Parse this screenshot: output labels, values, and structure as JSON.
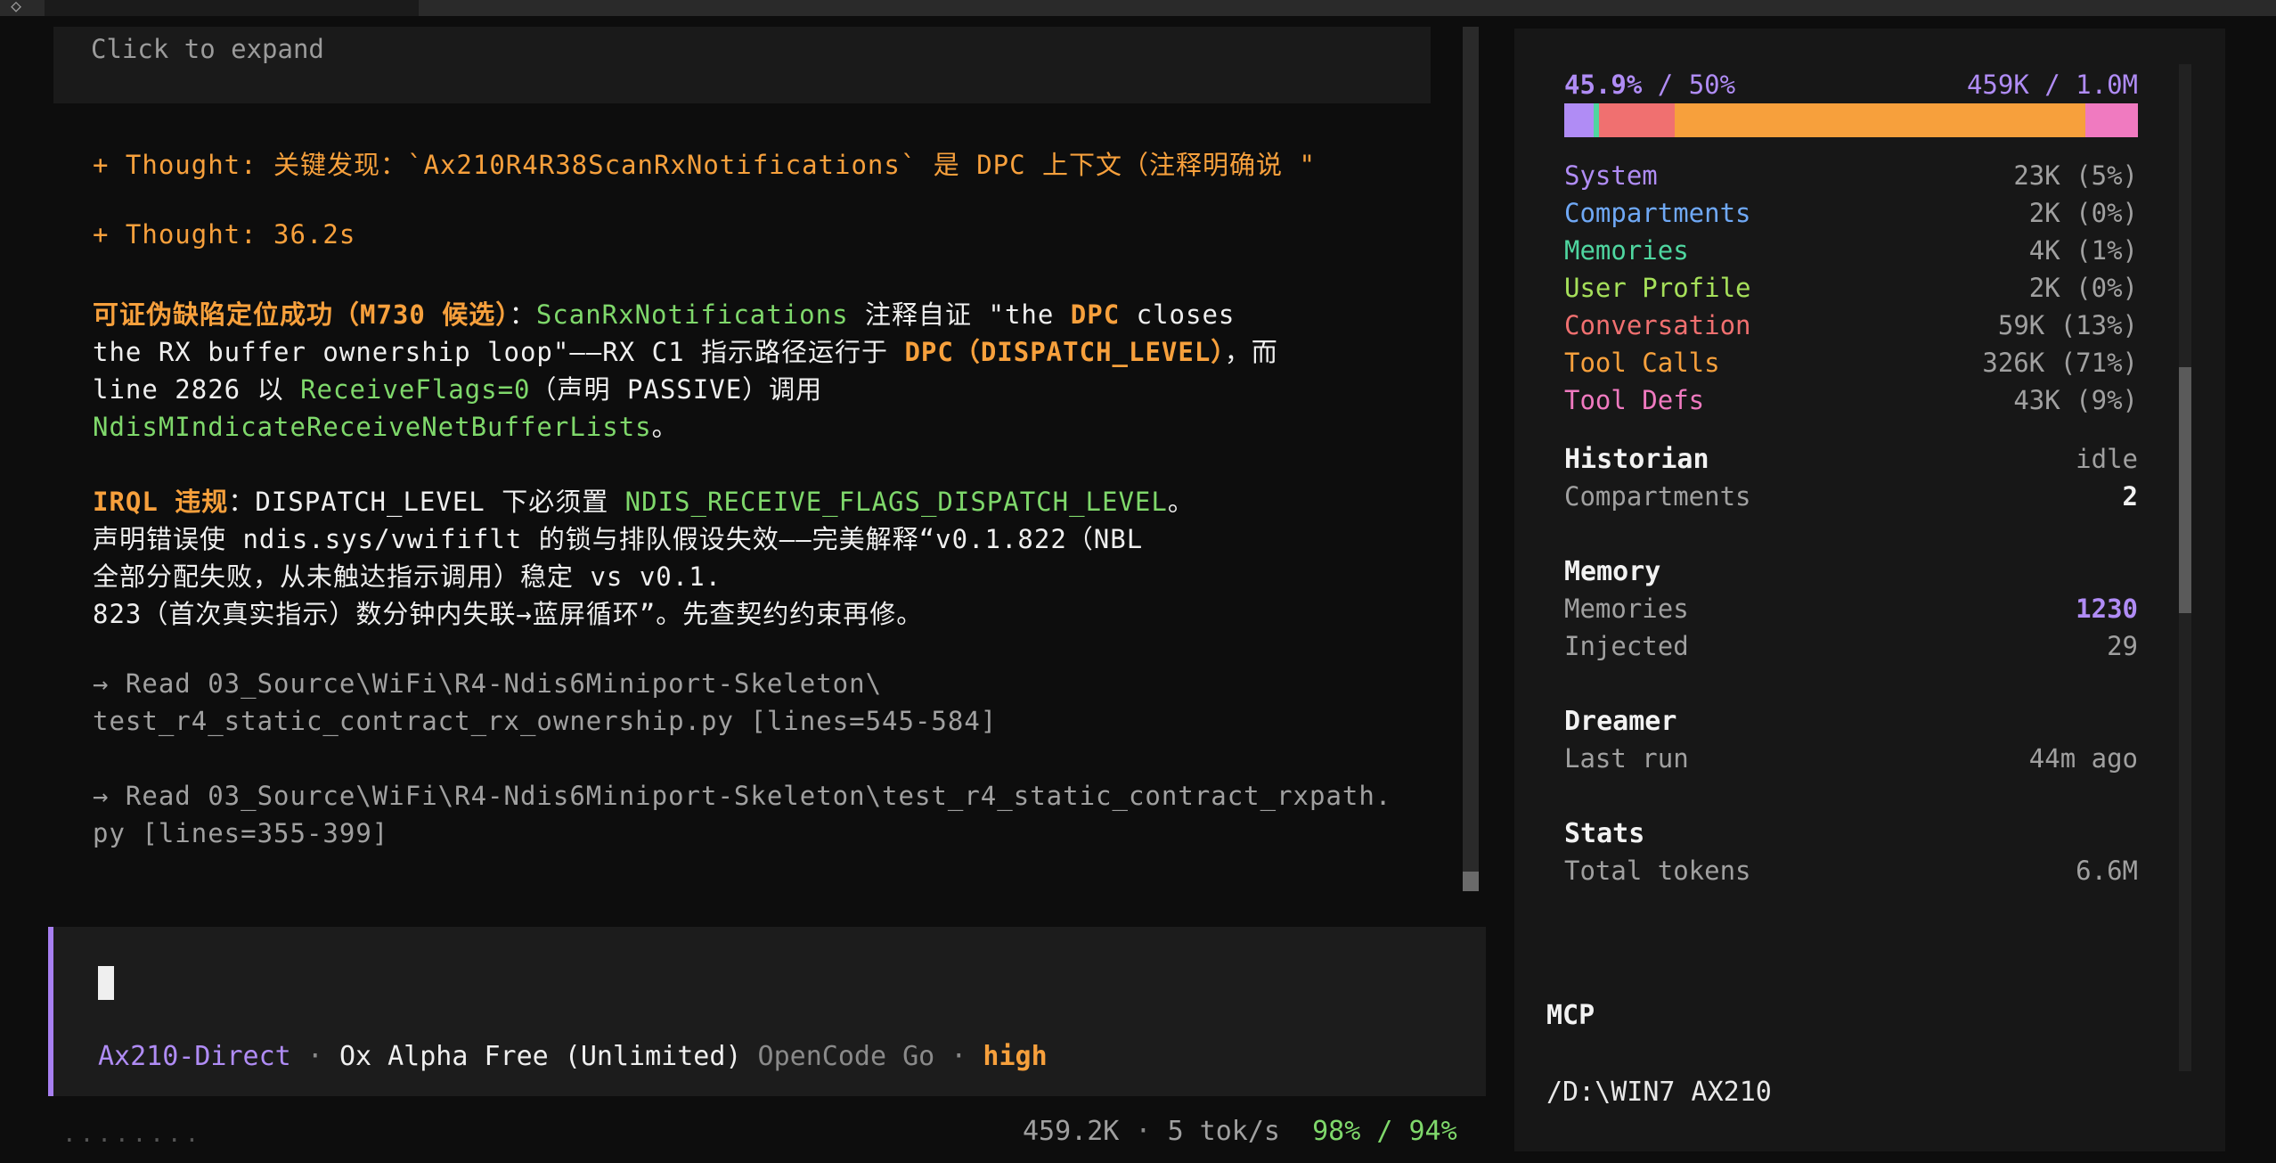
{
  "transcript": {
    "expand_hint": "Click to expand",
    "thought1": "+ Thought: 关键发现：`Ax210R4R38ScanRxNotifications` 是 DPC 上下文（注释明确说 \"",
    "thought2": "+ Thought: 36.2s",
    "p1_l1_a": "可证伪缺陷定位成功（M730 候选）",
    "p1_l1_b": "：",
    "p1_l1_c": "ScanRxNotifications",
    "p1_l1_d": " 注释自证 \"the ",
    "p1_l1_e": "DPC",
    "p1_l1_f": " closes",
    "p1_l2_a": "the RX buffer ownership loop\"——RX C1 指示路径运行于 ",
    "p1_l2_b": "DPC（DISPATCH_LEVEL）",
    "p1_l2_c": "，而",
    "p1_l3_a": "line 2826 以 ",
    "p1_l3_b": "ReceiveFlags=0",
    "p1_l3_c": "（声明 PASSIVE）调用",
    "p1_l4": "NdisMIndicateReceiveNetBufferLists",
    "p1_l4_end": "。",
    "p2_l1_a": "IRQL 违规",
    "p2_l1_b": "：DISPATCH_LEVEL 下必须置 ",
    "p2_l1_c": "NDIS_RECEIVE_FLAGS_DISPATCH_LEVEL",
    "p2_l1_d": "。",
    "p2_l2": "声明错误使 ndis.sys/vwififlt 的锁与排队假设失效——完美解释“v0.1.822（NBL",
    "p2_l3": "全部分配失败，从未触达指示调用）稳定 vs v0.1.",
    "p2_l4": "823（首次真实指示）数分钟内失联→蓝屏循环”。先查契约约束再修。",
    "read1_l1": "→ Read 03_Source\\WiFi\\R4-Ndis6Miniport-Skeleton\\",
    "read1_l2": "test_r4_static_contract_rx_ownership.py [lines=545-584]",
    "read2_l1": "→ Read 03_Source\\WiFi\\R4-Ndis6Miniport-Skeleton\\test_r4_static_contract_rxpath.",
    "read2_l2": "py [lines=355-399]"
  },
  "input": {
    "agent": "Ax210-Direct",
    "sep1": " · ",
    "model": "Ox Alpha Free (Unlimited)",
    "provider": " OpenCode Go",
    "sep2": " · ",
    "effort": "high"
  },
  "footer": {
    "dots": "........",
    "tokens": "459.2K",
    "sep": " · ",
    "rate": "5 tok/s",
    "usage": "98% / 94%"
  },
  "sidebar": {
    "context_pct": "45.9%",
    "context_limit": " / 50%",
    "context_tokens": "459K / 1.0M",
    "breakdown": [
      {
        "label": "System",
        "value": "23K (5%)",
        "color": "#b08cf5",
        "fraction": 0.05
      },
      {
        "label": "Compartments",
        "value": "2K (0%)",
        "color": "#6fa8f5",
        "fraction": 0.0
      },
      {
        "label": "Memories",
        "value": "4K (1%)",
        "color": "#4fd6a0",
        "fraction": 0.01
      },
      {
        "label": "User Profile",
        "value": "2K (0%)",
        "color": "#a6e05a",
        "fraction": 0.0
      },
      {
        "label": "Conversation",
        "value": "59K (13%)",
        "color": "#f07070",
        "fraction": 0.13
      },
      {
        "label": "Tool Calls",
        "value": "326K (71%)",
        "color": "#f7a03c",
        "fraction": 0.71
      },
      {
        "label": "Tool Defs",
        "value": "43K (9%)",
        "color": "#f07ac0",
        "fraction": 0.09
      }
    ],
    "historian": {
      "title": "Historian",
      "status": "idle",
      "compartments_label": "Compartments",
      "compartments_value": "2"
    },
    "memory": {
      "title": "Memory",
      "memories_label": "Memories",
      "memories_value": "1230",
      "injected_label": "Injected",
      "injected_value": "29"
    },
    "dreamer": {
      "title": "Dreamer",
      "last_run_label": "Last run",
      "last_run_value": "44m ago"
    },
    "stats": {
      "title": "Stats",
      "total_label": "Total tokens",
      "total_value": "6.6M"
    },
    "mcp_title": "MCP",
    "path": "/D:\\WIN7 AX210"
  }
}
